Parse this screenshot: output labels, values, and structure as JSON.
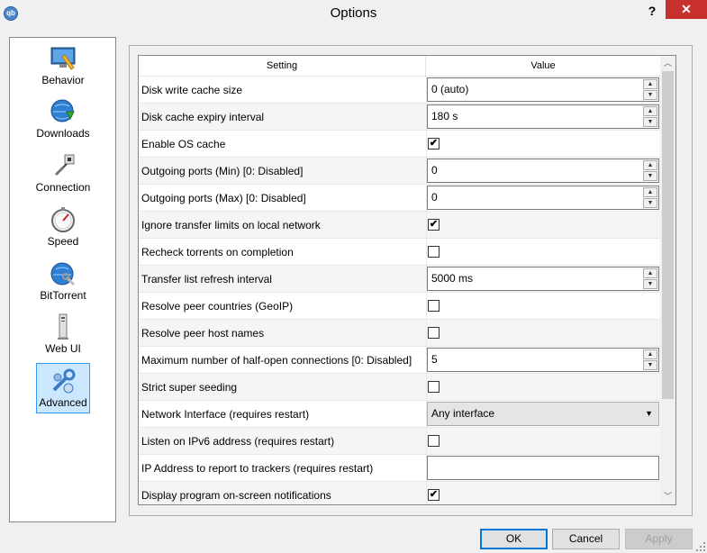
{
  "window": {
    "title": "Options",
    "help_label": "?",
    "close_label": "✕",
    "app_icon_text": "qb"
  },
  "sidebar": {
    "items": [
      {
        "label": "Behavior",
        "icon": "behavior-icon"
      },
      {
        "label": "Downloads",
        "icon": "downloads-icon"
      },
      {
        "label": "Connection",
        "icon": "connection-icon"
      },
      {
        "label": "Speed",
        "icon": "speed-icon"
      },
      {
        "label": "BitTorrent",
        "icon": "bittorrent-icon"
      },
      {
        "label": "Web UI",
        "icon": "webui-icon"
      },
      {
        "label": "Advanced",
        "icon": "advanced-icon"
      }
    ],
    "selected": "Advanced"
  },
  "table": {
    "headers": {
      "setting": "Setting",
      "value": "Value"
    },
    "rows": [
      {
        "label": "Disk write cache size",
        "type": "spin",
        "value": "0 (auto)"
      },
      {
        "label": "Disk cache expiry interval",
        "type": "spin",
        "value": "180 s"
      },
      {
        "label": "Enable OS cache",
        "type": "check",
        "checked": true
      },
      {
        "label": "Outgoing ports (Min) [0: Disabled]",
        "type": "spin",
        "value": "0"
      },
      {
        "label": "Outgoing ports (Max) [0: Disabled]",
        "type": "spin",
        "value": "0"
      },
      {
        "label": "Ignore transfer limits on local network",
        "type": "check",
        "checked": true
      },
      {
        "label": "Recheck torrents on completion",
        "type": "check",
        "checked": false
      },
      {
        "label": "Transfer list refresh interval",
        "type": "spin",
        "value": "5000 ms"
      },
      {
        "label": "Resolve peer countries (GeoIP)",
        "type": "check",
        "checked": false
      },
      {
        "label": "Resolve peer host names",
        "type": "check",
        "checked": false
      },
      {
        "label": "Maximum number of half-open connections [0: Disabled]",
        "type": "spin",
        "value": "5"
      },
      {
        "label": "Strict super seeding",
        "type": "check",
        "checked": false
      },
      {
        "label": "Network Interface (requires restart)",
        "type": "combo",
        "value": "Any interface"
      },
      {
        "label": "Listen on IPv6 address (requires restart)",
        "type": "check",
        "checked": false
      },
      {
        "label": "IP Address to report to trackers (requires restart)",
        "type": "text",
        "value": ""
      },
      {
        "label": "Display program on-screen notifications",
        "type": "check",
        "checked": true
      }
    ]
  },
  "buttons": {
    "ok": "OK",
    "cancel": "Cancel",
    "apply": "Apply"
  },
  "glyphs": {
    "check": "✔",
    "spin_up": "▲",
    "spin_down": "▼",
    "combo_arrow": "▼",
    "scroll_up": "︿",
    "scroll_down": "﹀"
  }
}
